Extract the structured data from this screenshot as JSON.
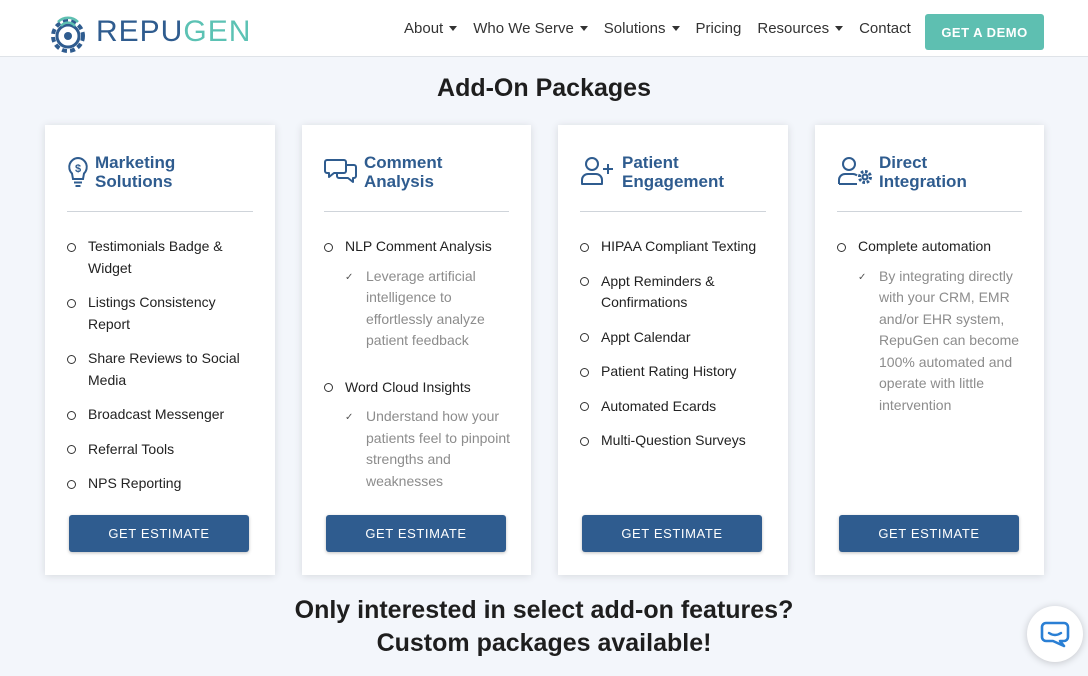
{
  "header": {
    "logo_text_a": "REPU",
    "logo_text_b": "GEN",
    "nav": [
      {
        "label": "About",
        "caret": true
      },
      {
        "label": "Who We Serve",
        "caret": true
      },
      {
        "label": "Solutions",
        "caret": true
      },
      {
        "label": "Pricing",
        "caret": false
      },
      {
        "label": "Resources",
        "caret": true
      },
      {
        "label": "Contact",
        "caret": false
      }
    ],
    "demo_button": "GET A DEMO"
  },
  "section_title": "Add-On Packages",
  "cards": [
    {
      "icon": "lightbulb-dollar-icon",
      "title_line1": "Marketing",
      "title_line2": "Solutions",
      "items": [
        {
          "text": "Testimonials Badge & Widget"
        },
        {
          "text": "Listings Consistency Report"
        },
        {
          "text": "Share Reviews to Social Media"
        },
        {
          "text": "Broadcast Messenger"
        },
        {
          "text": "Referral Tools"
        },
        {
          "text": "NPS Reporting"
        }
      ],
      "button": "GET ESTIMATE"
    },
    {
      "icon": "chat-bubbles-icon",
      "title_line1": "Comment",
      "title_line2": "Analysis",
      "items": [
        {
          "text": "NLP Comment Analysis",
          "sub": "Leverage artificial intelligence to effortlessly analyze patient feedback"
        },
        {
          "text": "Word Cloud Insights",
          "sub": "Understand how your patients feel to pinpoint strengths and weaknesses"
        }
      ],
      "button": "GET ESTIMATE"
    },
    {
      "icon": "user-plus-icon",
      "title_line1": "Patient",
      "title_line2": "Engagement",
      "items": [
        {
          "text": "HIPAA Compliant Texting"
        },
        {
          "text": "Appt Reminders & Confirmations"
        },
        {
          "text": "Appt Calendar"
        },
        {
          "text": "Patient Rating History"
        },
        {
          "text": "Automated Ecards"
        },
        {
          "text": "Multi-Question Surveys"
        }
      ],
      "button": "GET ESTIMATE"
    },
    {
      "icon": "user-gear-icon",
      "title_line1": "Direct",
      "title_line2": "Integration",
      "items": [
        {
          "text": "Complete automation",
          "sub": "By integrating directly with your CRM, EMR and/or EHR system, RepuGen can become 100% automated and operate with little intervention"
        }
      ],
      "button": "GET ESTIMATE"
    }
  ],
  "bottom_line1": "Only interested in select add-on features?",
  "bottom_line2": "Custom packages available!",
  "chat_icon": "chat-icon",
  "colors": {
    "brand_blue": "#2f5c8f",
    "brand_teal": "#5ebfb1",
    "background": "#f3f6fb"
  }
}
